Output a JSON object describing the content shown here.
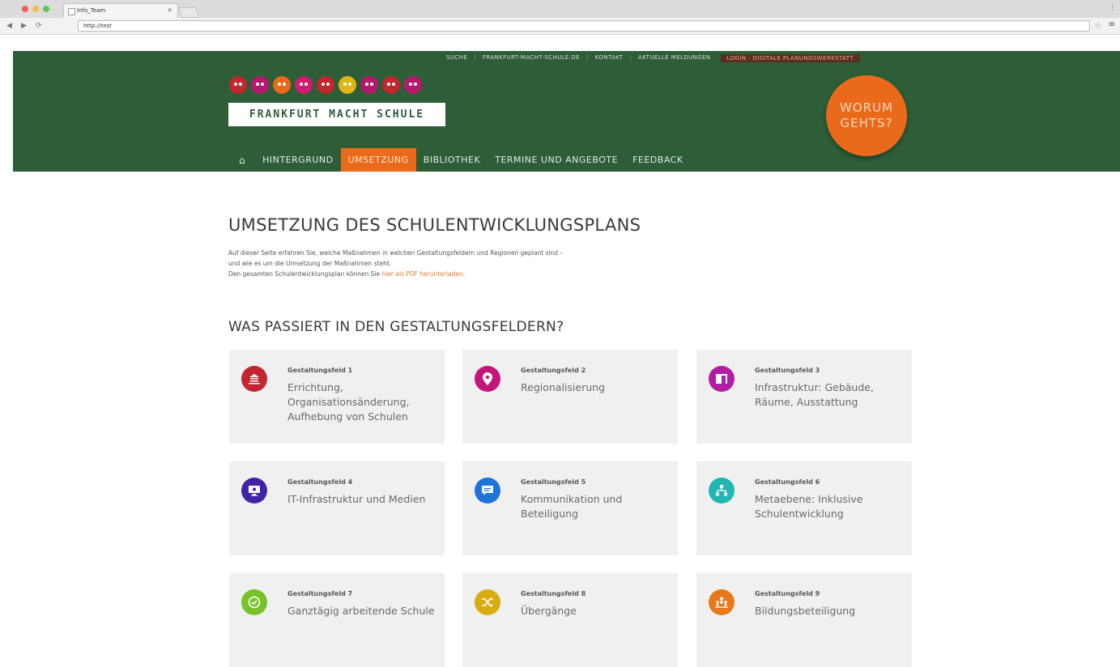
{
  "browser": {
    "tab_title": "Info_Team",
    "url": "http://test",
    "traffic_colors": [
      "#ee5f57",
      "#f5bd4f",
      "#61c454"
    ]
  },
  "header": {
    "bg_color": "#2d5e37",
    "top_nav": [
      "SUCHE",
      "FRANKFURT-MACHT-SCHULE.DE",
      "KONTAKT",
      "AKTUELLE MELDUNGEN"
    ],
    "top_nav_special": "LOGIN · DIGITALE PLANUNGSWERKSTATT",
    "logo_text": "FRANKFURT MACHT SCHULE",
    "mascot_colors": [
      "#c2262e",
      "#b5186d",
      "#ea6a1c",
      "#d01c6e",
      "#c2262e",
      "#e0b413",
      "#b5186d",
      "#c2262e",
      "#b5186d"
    ],
    "warum_line1": "WORUM",
    "warum_line2": "GEHTS?",
    "main_nav": {
      "home_icon": "home-icon",
      "items": [
        "HINTERGRUND",
        "UMSETZUNG",
        "BIBLIOTHEK",
        "TERMINE UND ANGEBOTE",
        "FEEDBACK"
      ],
      "active_index": 1
    }
  },
  "content": {
    "title": "UMSETZUNG DES SCHULENTWICKLUNGSPLANS",
    "intro_line1": "Auf dieser Seite erfahren Sie, welche Maßnahmen in welchen Gestaltungsfeldern und Regionen geplant sind –",
    "intro_line2": "und wie es um die Umsetzung der Maßnahmen steht.",
    "intro_line3_prefix": "Den gesamten Schulentwicklungsplan können Sie ",
    "intro_link": "hier als PDF herunterladen",
    "intro_line3_suffix": ".",
    "section_title": "WAS PASSIERT IN DEN GESTALTUNGSFELDERN?"
  },
  "fields": [
    {
      "kicker": "Gestaltungsfeld 1",
      "title": "Errichtung, Organisationsänderung, Aufhebung von Schulen",
      "color": "#c2262e",
      "icon": "school-building-icon"
    },
    {
      "kicker": "Gestaltungsfeld 2",
      "title": "Regionalisierung",
      "color": "#c2167a",
      "icon": "map-pin-icon"
    },
    {
      "kicker": "Gestaltungsfeld 3",
      "title": "Infrastruktur: Gebäude, Räume, Ausstattung",
      "color": "#b31ca5",
      "icon": "door-icon"
    },
    {
      "kicker": "Gestaltungsfeld 4",
      "title": "IT-Infrastruktur und Medien",
      "color": "#4322a6",
      "icon": "monitor-icon"
    },
    {
      "kicker": "Gestaltungsfeld 5",
      "title": "Kommunikation und Beteiligung",
      "color": "#1e73d8",
      "icon": "chat-icon"
    },
    {
      "kicker": "Gestaltungsfeld 6",
      "title": "Metaebene: Inklusive Schulentwicklung",
      "color": "#23b5b0",
      "icon": "hierarchy-icon"
    },
    {
      "kicker": "Gestaltungsfeld 7",
      "title": "Ganztägig arbeitende Schule",
      "color": "#78c22a",
      "icon": "clock-icon"
    },
    {
      "kicker": "Gestaltungsfeld 8",
      "title": "Übergänge",
      "color": "#d7ad12",
      "icon": "shuffle-icon"
    },
    {
      "kicker": "Gestaltungsfeld 9",
      "title": "Bildungsbeteiligung",
      "color": "#e67a19",
      "icon": "people-icon"
    }
  ]
}
